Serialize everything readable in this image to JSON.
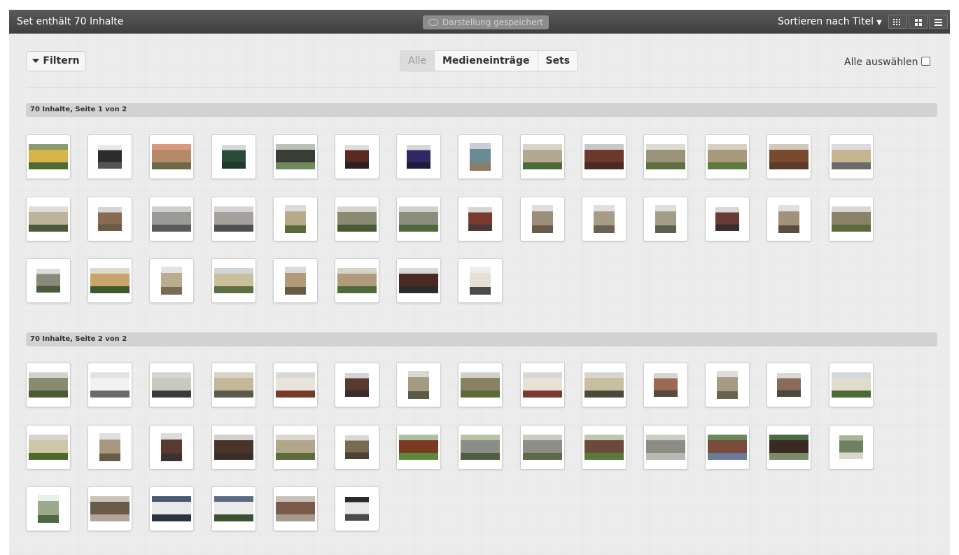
{
  "topbar": {
    "set_title": "Set enthält 70 Inhalte",
    "saved_label": "Darstellung gespeichert",
    "sort_label": "Sortieren nach Titel",
    "view_modes": [
      "grid-small-icon",
      "grid-large-icon",
      "list-icon"
    ]
  },
  "toolbar": {
    "filter_label": "Filtern",
    "segments": [
      "Alle",
      "Medieneinträge",
      "Sets"
    ],
    "active_segment": "Alle",
    "select_all_label": "Alle auswählen"
  },
  "pages": [
    {
      "label": "70 Inhalte, Seite 1 von 2",
      "items": [
        {
          "shape": "wide",
          "colors": [
            "#8a9a6e",
            "#d6b44a",
            "#4f6a33"
          ]
        },
        {
          "shape": "square",
          "colors": [
            "#e9e9e9",
            "#2c2c2c",
            "#555555"
          ]
        },
        {
          "shape": "wide",
          "colors": [
            "#d79a7c",
            "#b58a6a",
            "#6b6a45"
          ]
        },
        {
          "shape": "square",
          "colors": [
            "#d8d8d8",
            "#2b4a38",
            "#1f3a2b"
          ]
        },
        {
          "shape": "wide",
          "colors": [
            "#b9c0b6",
            "#3a3d35",
            "#6f8a5c"
          ]
        },
        {
          "shape": "square",
          "colors": [
            "#dedede",
            "#5a2a22",
            "#2a2222"
          ]
        },
        {
          "shape": "square",
          "colors": [
            "#d7d7d7",
            "#2f2a66",
            "#1c1c3a"
          ]
        },
        {
          "shape": "tall",
          "colors": [
            "#c9cfd4",
            "#6a8a96",
            "#8c7b66"
          ]
        },
        {
          "shape": "wide",
          "colors": [
            "#d8d4c8",
            "#b5a890",
            "#4f6a3a"
          ]
        },
        {
          "shape": "wide",
          "colors": [
            "#c8c8c8",
            "#6b3a2c",
            "#4a2a22"
          ]
        },
        {
          "shape": "wide",
          "colors": [
            "#dcdcd4",
            "#9b947a",
            "#5c7040"
          ]
        },
        {
          "shape": "wide",
          "colors": [
            "#d6d2c2",
            "#a89b7c",
            "#5f7a3f"
          ]
        },
        {
          "shape": "wide",
          "colors": [
            "#cfc8bb",
            "#7a4a30",
            "#5a3a28"
          ]
        },
        {
          "shape": "wide",
          "colors": [
            "#dcdcdc",
            "#c5b590",
            "#6a6a6a"
          ]
        },
        {
          "shape": "wide",
          "colors": [
            "#dedbd2",
            "#bcb39a",
            "#4b5a3a"
          ]
        },
        {
          "shape": "square",
          "colors": [
            "#d5d5d5",
            "#8a6a52",
            "#6a5a46"
          ]
        },
        {
          "shape": "wide",
          "colors": [
            "#cfcfcf",
            "#9a9a96",
            "#5a5a5a"
          ]
        },
        {
          "shape": "wide",
          "colors": [
            "#d4d4d4",
            "#a5a29e",
            "#4f4f4f"
          ]
        },
        {
          "shape": "tall",
          "colors": [
            "#dcdcdc",
            "#b7aa86",
            "#5b6a3a"
          ]
        },
        {
          "shape": "wide",
          "colors": [
            "#d4d4cc",
            "#8a8a72",
            "#4a5a32"
          ]
        },
        {
          "shape": "wide",
          "colors": [
            "#cfd2cc",
            "#8a8e7a",
            "#4e6a3c"
          ]
        },
        {
          "shape": "square",
          "colors": [
            "#d6d6d6",
            "#7a3a30",
            "#4a3a36"
          ]
        },
        {
          "shape": "tall",
          "colors": [
            "#dedede",
            "#9b8f7c",
            "#6a5a4a"
          ]
        },
        {
          "shape": "tall",
          "colors": [
            "#e0e0e0",
            "#a89b86",
            "#6b6252"
          ]
        },
        {
          "shape": "tall",
          "colors": [
            "#dedede",
            "#a29d88",
            "#5f5f4e"
          ]
        },
        {
          "shape": "square",
          "colors": [
            "#d8d8d8",
            "#6a3a34",
            "#3a2e2a"
          ]
        },
        {
          "shape": "tall",
          "colors": [
            "#e0e0e0",
            "#a3927a",
            "#5a4e42"
          ]
        },
        {
          "shape": "wide",
          "colors": [
            "#d8d8d0",
            "#8a8268",
            "#5c6a3a"
          ]
        },
        {
          "shape": "square",
          "colors": [
            "#dcdcdc",
            "#8a8a7a",
            "#4a5a3a"
          ]
        },
        {
          "shape": "wide",
          "colors": [
            "#dcd8cc",
            "#c9a36a",
            "#3b5a2c"
          ]
        },
        {
          "shape": "tall",
          "colors": [
            "#e3e3e3",
            "#b9ad8f",
            "#7a6a52"
          ]
        },
        {
          "shape": "wide",
          "colors": [
            "#cfd4d8",
            "#c9c09a",
            "#5a7040"
          ]
        },
        {
          "shape": "tall",
          "colors": [
            "#dadada",
            "#b39a78",
            "#6a5a44"
          ]
        },
        {
          "shape": "wide",
          "colors": [
            "#d6d2c8",
            "#b09a7c",
            "#4e6a38"
          ]
        },
        {
          "shape": "wide",
          "colors": [
            "#d8d8d8",
            "#4a2a22",
            "#2e2a2a"
          ]
        },
        {
          "shape": "tall",
          "colors": [
            "#ececec",
            "#e4e0d6",
            "#4a4a4a"
          ]
        }
      ]
    },
    {
      "label": "70 Inhalte, Seite 2 von 2",
      "items": [
        {
          "shape": "wide",
          "colors": [
            "#d2d2cc",
            "#8a8a70",
            "#4a5a34"
          ]
        },
        {
          "shape": "wide",
          "colors": [
            "#e2e2e2",
            "#f2f2f2",
            "#6a6a6a"
          ]
        },
        {
          "shape": "wide",
          "colors": [
            "#d4d4d4",
            "#c9c9c0",
            "#3a3a3a"
          ]
        },
        {
          "shape": "wide",
          "colors": [
            "#d6d2c8",
            "#c4b79a",
            "#5a5a4a"
          ]
        },
        {
          "shape": "wide",
          "colors": [
            "#d8d8d8",
            "#e8e4dc",
            "#7a3a2a"
          ]
        },
        {
          "shape": "square",
          "colors": [
            "#d4d4d4",
            "#5a3a30",
            "#3a2e2a"
          ]
        },
        {
          "shape": "tall",
          "colors": [
            "#d8d8d4",
            "#a49b82",
            "#5a5a48"
          ]
        },
        {
          "shape": "wide",
          "colors": [
            "#cfd0c8",
            "#8a8062",
            "#5a6a38"
          ]
        },
        {
          "shape": "wide",
          "colors": [
            "#d8d8d8",
            "#e8e2d6",
            "#7a3a30"
          ]
        },
        {
          "shape": "wide",
          "colors": [
            "#d6d6d0",
            "#c8bea0",
            "#4a4a3a"
          ]
        },
        {
          "shape": "square",
          "colors": [
            "#d6d6d6",
            "#9a6a52",
            "#5a4a3e"
          ]
        },
        {
          "shape": "tall",
          "colors": [
            "#dcdcdc",
            "#a59a82",
            "#6a6250"
          ]
        },
        {
          "shape": "square",
          "colors": [
            "#d8d8d8",
            "#8a6a58",
            "#4a4a3a"
          ]
        },
        {
          "shape": "wide",
          "colors": [
            "#d2d8dc",
            "#e0dccc",
            "#4b6a34"
          ]
        },
        {
          "shape": "wide",
          "colors": [
            "#d6d4cc",
            "#cfc6a8",
            "#4b6a2e"
          ]
        },
        {
          "shape": "tall",
          "colors": [
            "#e0e0e0",
            "#a89880",
            "#6a5a48"
          ]
        },
        {
          "shape": "tall",
          "colors": [
            "#dcdcdc",
            "#5a3a30",
            "#3a3330"
          ]
        },
        {
          "shape": "wide",
          "colors": [
            "#d2d2cc",
            "#4a3328",
            "#3a2e28"
          ]
        },
        {
          "shape": "wide",
          "colors": [
            "#d8d8d0",
            "#b2a68a",
            "#5b6b3a"
          ]
        },
        {
          "shape": "square",
          "colors": [
            "#d8d8d8",
            "#7a6a50",
            "#4a4236"
          ]
        },
        {
          "shape": "wide",
          "colors": [
            "#aac0a0",
            "#7a3a22",
            "#5a8a3a"
          ]
        },
        {
          "shape": "wide",
          "colors": [
            "#b7c2a6",
            "#8a8e86",
            "#4e5e42"
          ]
        },
        {
          "shape": "wide",
          "colors": [
            "#c9ccc2",
            "#8e8e86",
            "#5a6a4a"
          ]
        },
        {
          "shape": "wide",
          "colors": [
            "#bcc8ae",
            "#6a4a3a",
            "#5a7a3a"
          ]
        },
        {
          "shape": "wide",
          "colors": [
            "#c7cfc4",
            "#8c8c84",
            "#b8b8b0"
          ]
        },
        {
          "shape": "wide",
          "colors": [
            "#6a8a5a",
            "#7a4a3a",
            "#6a7a9a"
          ]
        },
        {
          "shape": "wide",
          "colors": [
            "#4a6a44",
            "#3a2a24",
            "#7a8a6a"
          ]
        },
        {
          "shape": "square",
          "colors": [
            "#a8b79c",
            "#6e7f62",
            "#d8d8c8"
          ]
        },
        {
          "shape": "tall",
          "colors": [
            "#e8efe6",
            "#9aa88c",
            "#4e6a44"
          ]
        },
        {
          "shape": "wide",
          "colors": [
            "#c8c4bc",
            "#6a5a4a",
            "#b4a49a"
          ]
        },
        {
          "shape": "wide",
          "colors": [
            "#4a5a70",
            "#e8e8e8",
            "#2a3444"
          ]
        },
        {
          "shape": "wide",
          "colors": [
            "#5a6c84",
            "#eaeaea",
            "#3a5030"
          ]
        },
        {
          "shape": "wide",
          "colors": [
            "#c8c0b8",
            "#7a5a48",
            "#a49a8c"
          ]
        },
        {
          "shape": "square",
          "colors": [
            "#2a2a2a",
            "#e8e8e8",
            "#4a4a4a"
          ]
        }
      ]
    }
  ]
}
